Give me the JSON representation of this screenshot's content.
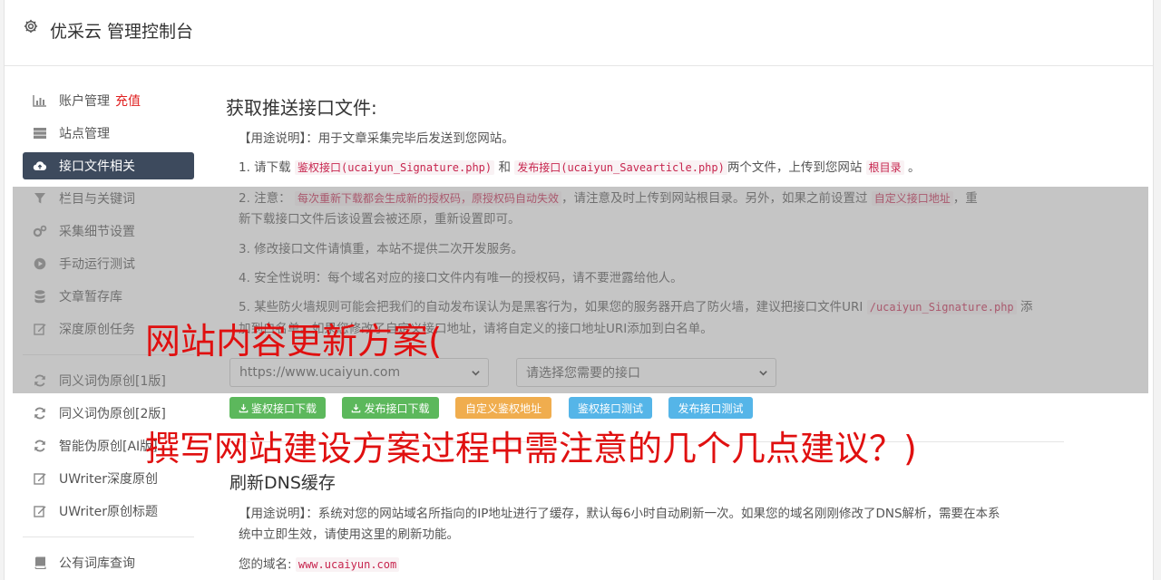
{
  "header": {
    "title": "优采云 管理控制台",
    "icon": "gear-icon"
  },
  "sidebar": {
    "items": [
      {
        "label": "账户管理",
        "extra": "充值",
        "icon": "bar-chart-icon"
      },
      {
        "label": "站点管理",
        "icon": "server-icon"
      },
      {
        "label": "接口文件相关",
        "icon": "cloud-upload-icon",
        "active": true
      },
      {
        "label": "栏目与关键词",
        "icon": "filter-icon"
      },
      {
        "label": "采集细节设置",
        "icon": "cogs-icon"
      },
      {
        "label": "手动运行测试",
        "icon": "play-circle-icon"
      },
      {
        "label": "文章暂存库",
        "icon": "database-icon"
      },
      {
        "label": "深度原创任务",
        "icon": "edit-icon"
      },
      {
        "label": "同义词伪原创[1版]",
        "icon": "refresh-icon"
      },
      {
        "label": "同义词伪原创[2版]",
        "icon": "refresh-icon"
      },
      {
        "label": "智能伪原创[AI版]",
        "icon": "refresh-icon"
      },
      {
        "label": "UWriter深度原创",
        "icon": "edit-icon"
      },
      {
        "label": "UWriter原创标题",
        "icon": "edit-icon"
      },
      {
        "label": "公有词库查询",
        "icon": "book-icon"
      }
    ]
  },
  "section1": {
    "title": "获取推送接口文件:",
    "usage": "【用途说明】：用于文章采集完毕后发送到您网站。",
    "step1": {
      "prefix": "1. 请下载",
      "code1": "鉴权接口(ucaiyun_Signature.php)",
      "mid": "和",
      "code2": "发布接口(ucaiyun_Savearticle.php)",
      "suffix": "两个文件，上传到您网站",
      "code3": "根目录",
      "end": "。"
    },
    "step2": {
      "prefix": "2. 注意：",
      "code1": "每次重新下载都会生成新的授权码，原授权码自动失效",
      "mid": "，请注意及时上传到网站根目录。另外，如果之前设置过",
      "code2": "自定义接口地址",
      "suffix": "，重",
      "line2": "新下载接口文件后该设置会被还原，重新设置即可。"
    },
    "step3": "3. 修改接口文件请慎重，本站不提供二次开发服务。",
    "step4": "4. 安全性说明：每个域名对应的接口文件内有唯一的授权码，请不要泄露给他人。",
    "step5": {
      "prefix": "5. 某些防火墙规则可能会把我们的自动发布误认为是黑客行为，如果您的服务器开启了防火墙，建议把接口文件URI",
      "code1": "/ucaiyun_Signature.php",
      "suffix": "添",
      "line2": "加到白名单。如果您修改了自定义接口地址，请将自定义的接口地址URI添加到白名单。"
    },
    "site_select": "https://www.ucaiyun.com",
    "api_select": "请选择您需要的接口",
    "buttons": {
      "download_sig": "鉴权接口下载",
      "download_pub": "发布接口下载",
      "custom": "自定义鉴权地址",
      "test_sig": "鉴权接口测试",
      "test_pub": "发布接口测试"
    }
  },
  "section2": {
    "title": "刷新DNS缓存",
    "usage_line1": "【用途说明】：系统对您的网站域名所指向的IP地址进行了缓存，默认每6小时自动刷新一次。如果您的域名刚刚修改了DNS解析，需要在本系",
    "usage_line2": "统中立即生效，请使用这里的刷新功能。",
    "domain_label": "您的域名:",
    "domain_value": "www.ucaiyun.com"
  },
  "overlay_text": {
    "line1": "网站内容更新方案(",
    "line2": "撰写网站建设方案过程中需注意的几个几点建议？)"
  },
  "colors": {
    "active_bg": "#3d4a5d",
    "green": "#5cb85c",
    "orange": "#f0ad4e",
    "blue": "#55b5e8",
    "red": "#e01010"
  }
}
